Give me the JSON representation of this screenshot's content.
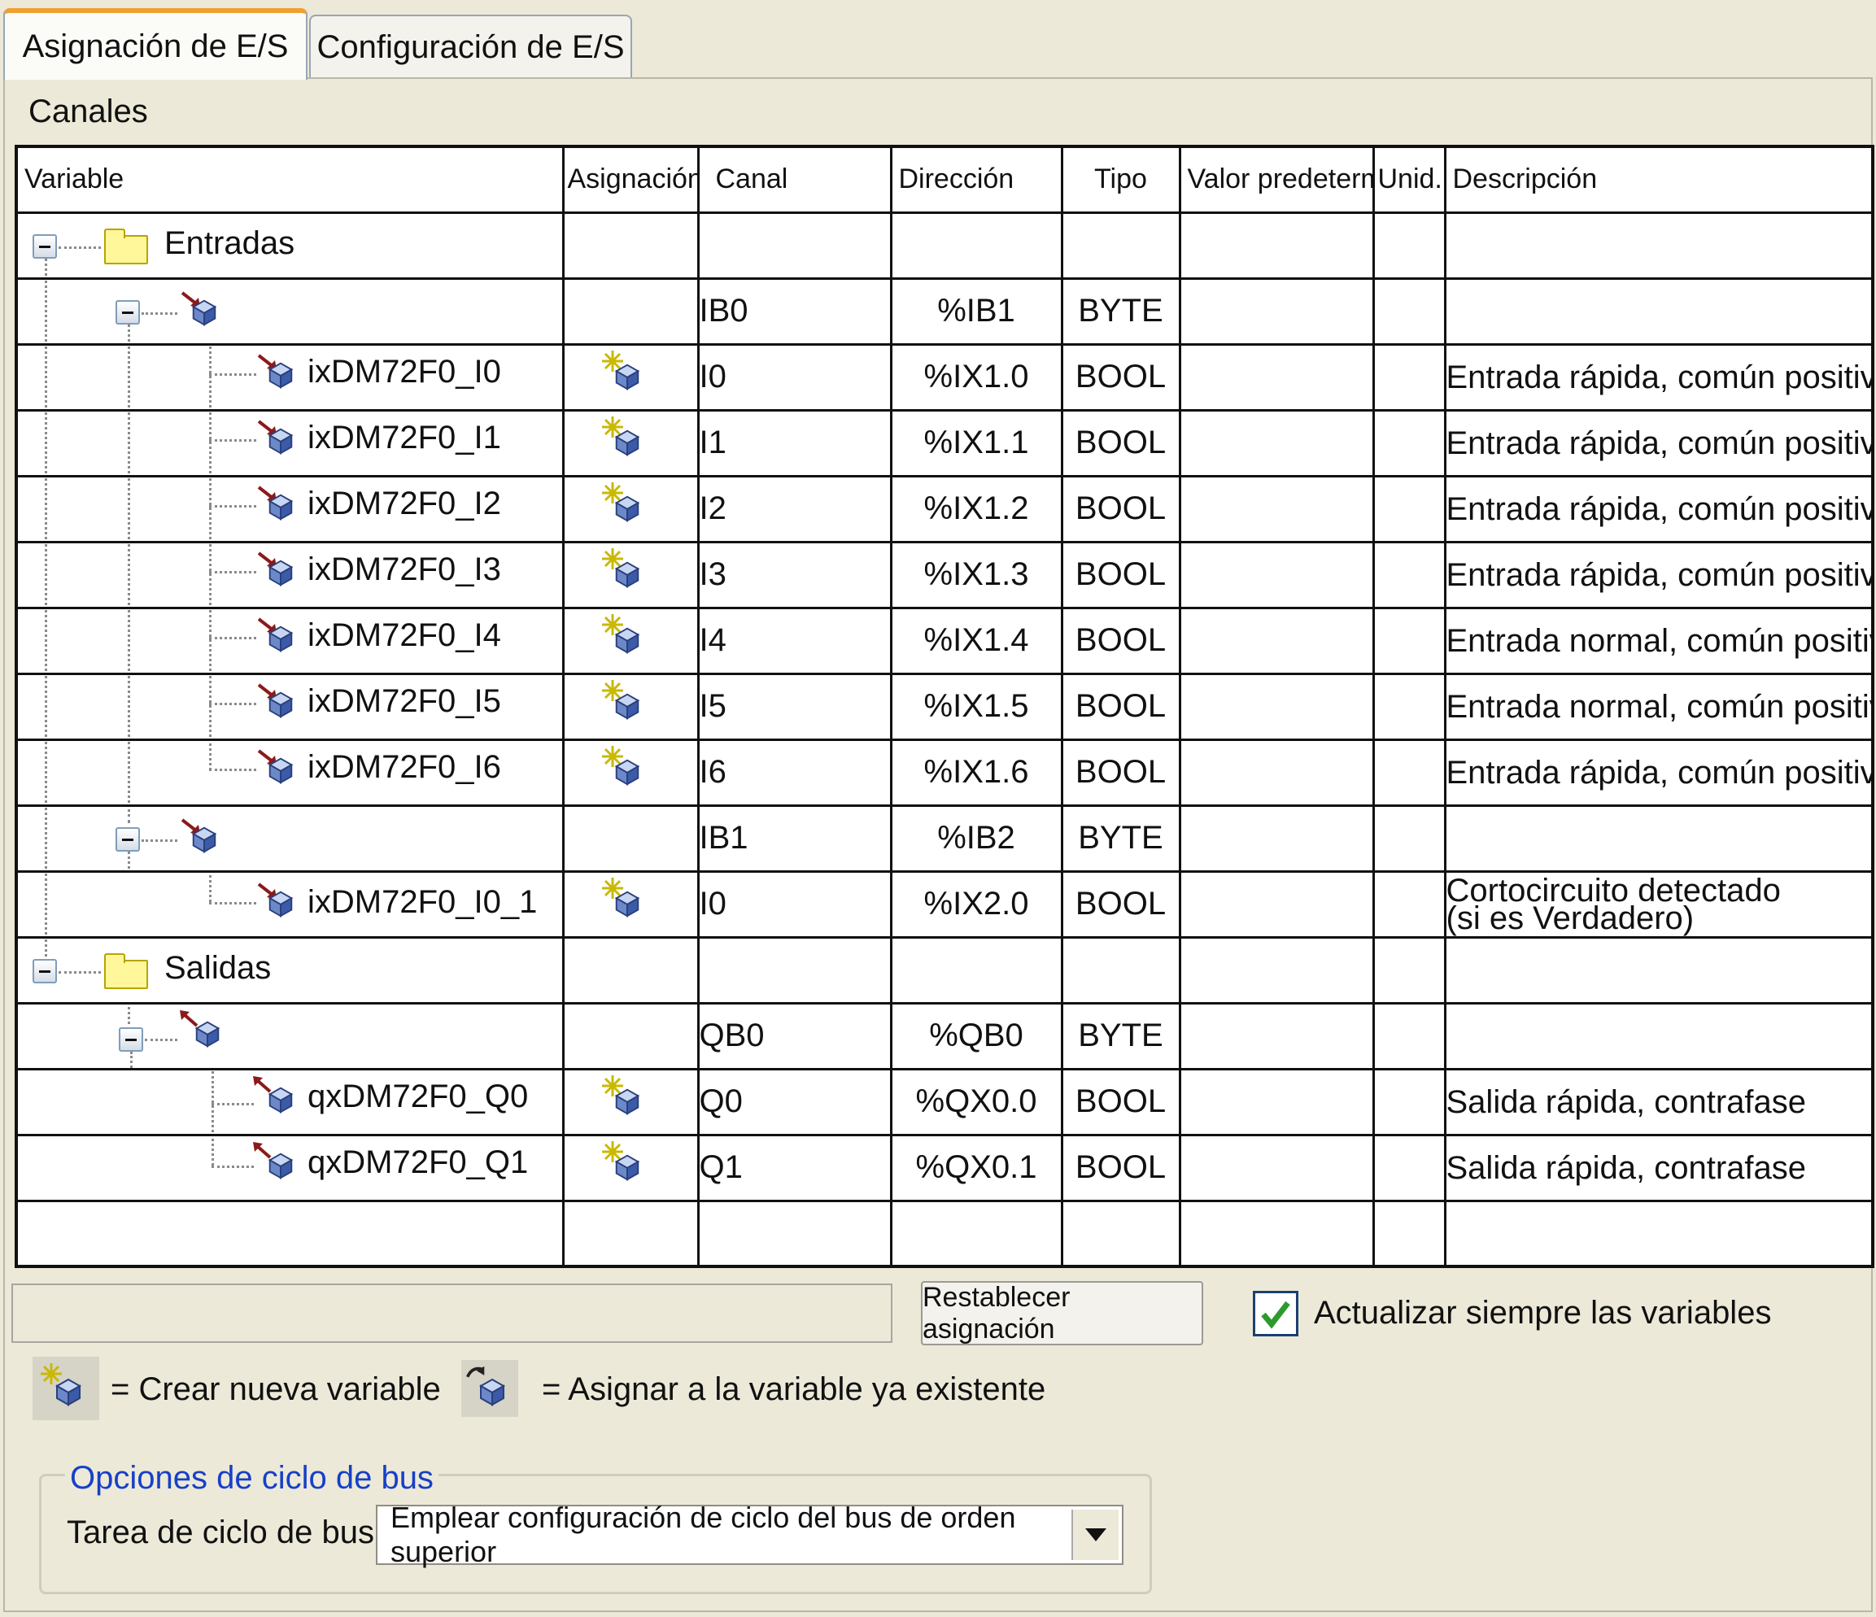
{
  "tabs": [
    {
      "label": "Asignación de E/S",
      "active": true
    },
    {
      "label": "Configuración de E/S",
      "active": false
    }
  ],
  "section_label": "Canales",
  "columns": [
    "Variable",
    "Asignación",
    "Canal",
    "Dirección",
    "Tipo",
    "Valor predeterm.",
    "Unid.",
    "Descripción"
  ],
  "rows": {
    "r0": {
      "variable": "Entradas"
    },
    "r1": {
      "canal": "IB0",
      "direccion": "%IB1",
      "tipo": "BYTE"
    },
    "r2": {
      "variable": "ixDM72F0_I0",
      "canal": "I0",
      "direccion": "%IX1.0",
      "tipo": "BOOL",
      "descripcion": "Entrada rápida, común positivo"
    },
    "r3": {
      "variable": "ixDM72F0_I1",
      "canal": "I1",
      "direccion": "%IX1.1",
      "tipo": "BOOL",
      "descripcion": "Entrada rápida, común positivo"
    },
    "r4": {
      "variable": "ixDM72F0_I2",
      "canal": "I2",
      "direccion": "%IX1.2",
      "tipo": "BOOL",
      "descripcion": "Entrada rápida, común positivo"
    },
    "r5": {
      "variable": "ixDM72F0_I3",
      "canal": "I3",
      "direccion": "%IX1.3",
      "tipo": "BOOL",
      "descripcion": "Entrada rápida, común positivo"
    },
    "r6": {
      "variable": "ixDM72F0_I4",
      "canal": "I4",
      "direccion": "%IX1.4",
      "tipo": "BOOL",
      "descripcion": "Entrada normal, común positivo"
    },
    "r7": {
      "variable": "ixDM72F0_I5",
      "canal": "I5",
      "direccion": "%IX1.5",
      "tipo": "BOOL",
      "descripcion": "Entrada normal, común positivo"
    },
    "r8": {
      "variable": "ixDM72F0_I6",
      "canal": "I6",
      "direccion": "%IX1.6",
      "tipo": "BOOL",
      "descripcion": "Entrada rápida, común positivo"
    },
    "r9": {
      "canal": "IB1",
      "direccion": "%IB2",
      "tipo": "BYTE"
    },
    "r10": {
      "variable": "ixDM72F0_I0_1",
      "canal": "I0",
      "direccion": "%IX2.0",
      "tipo": "BOOL",
      "descripcion_l1": "Cortocircuito detectado",
      "descripcion_l2": "(si es Verdadero)"
    },
    "r11": {
      "variable": "Salidas"
    },
    "r12": {
      "canal": "QB0",
      "direccion": "%QB0",
      "tipo": "BYTE"
    },
    "r13": {
      "variable": "qxDM72F0_Q0",
      "canal": "Q0",
      "direccion": "%QX0.0",
      "tipo": "BOOL",
      "descripcion": "Salida rápida, contrafase"
    },
    "r14": {
      "variable": "qxDM72F0_Q1",
      "canal": "Q1",
      "direccion": "%QX0.1",
      "tipo": "BOOL",
      "descripcion": "Salida rápida, contrafase"
    }
  },
  "reset_button": "Restablecer asignación",
  "always_update": {
    "label": "Actualizar siempre las variables",
    "checked": true
  },
  "legend": {
    "create": "= Crear nueva variable",
    "assign": "= Asignar a la variable ya existente"
  },
  "bus_cycle": {
    "group_title": "Opciones de ciclo de bus",
    "label": "Tarea de ciclo de bus",
    "selected": "Emplear configuración de ciclo del bus de orden superior"
  },
  "icons": {
    "input_channel": "input-channel-icon",
    "output_channel": "output-channel-icon",
    "create_variable": "create-variable-icon",
    "assign_variable": "assign-variable-icon",
    "folder": "folder-icon"
  },
  "colors": {
    "background": "#ece9d8",
    "active_tab_accent": "#f0a030",
    "group_title": "#1740c8",
    "check_mark": "#2e9a2e",
    "folder": "#fff79a"
  }
}
